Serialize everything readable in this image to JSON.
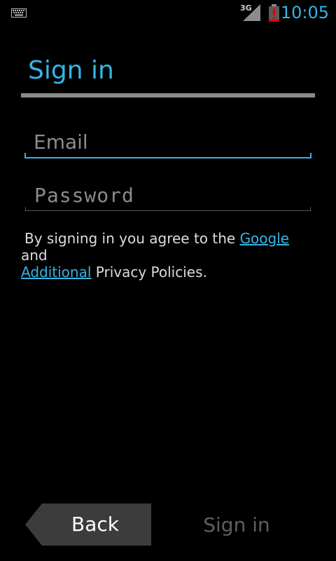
{
  "status_bar": {
    "keyboard_icon": "keyboard-icon",
    "network_type": "3G",
    "signal_icon": "cell-signal-icon",
    "battery_icon": "battery-low-icon",
    "time": "10:05"
  },
  "title": "Sign in",
  "email": {
    "placeholder": "Email",
    "value": ""
  },
  "password": {
    "placeholder": "Password",
    "value": ""
  },
  "terms": {
    "prefix": "By signing in you agree to the",
    "link1": "Google",
    "middle": "and",
    "link2": "Additional",
    "suffix": "Privacy Policies."
  },
  "footer": {
    "back_label": "Back",
    "signin_label": "Sign in"
  },
  "colors": {
    "accent": "#33b5e5",
    "background": "#000000",
    "battery_warning": "#e00000",
    "disabled_text": "#5e5e5e"
  }
}
